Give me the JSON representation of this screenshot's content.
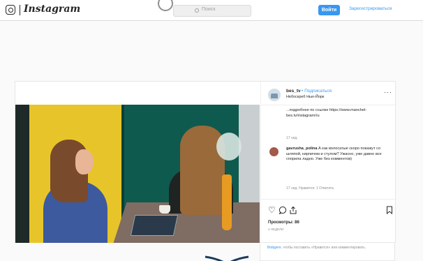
{
  "header": {
    "wordmark": "Instagram",
    "search_placeholder": "Поиск",
    "login_label": "Войти",
    "signup_label": "Зарегистрироваться",
    "logo_icon": "instagram-camera-icon",
    "accent": "#3897f0"
  },
  "post": {
    "username": "bes_tv",
    "follow_label": "• Подписаться",
    "location": "Небоскреб Нью-Йорк",
    "more_icon": "more-horizontal-icon",
    "comments": [
      {
        "text": "...подробнее по ссылке https://www.manchel-bes.tv/instagram/ru",
        "time": "17 нед."
      },
      {
        "user": "gavrusha_polina",
        "text": "А как волосатые скоро покажут со шляпой, кирпичом и стулом? Ужасно, уже давно все спорила ладно. Уже без комментов)",
        "meta": "17 нед.   Нравится: 1   Ответить"
      }
    ],
    "icons": [
      "heart-icon",
      "comment-icon",
      "share-icon",
      "save-icon"
    ],
    "views": "Просмотры: 86",
    "time_ago": "4 НЕДЕЛИ"
  },
  "below": {
    "login_link": "Войдите",
    "text": ", чтобы поставить «Нравится» или комментировать."
  }
}
